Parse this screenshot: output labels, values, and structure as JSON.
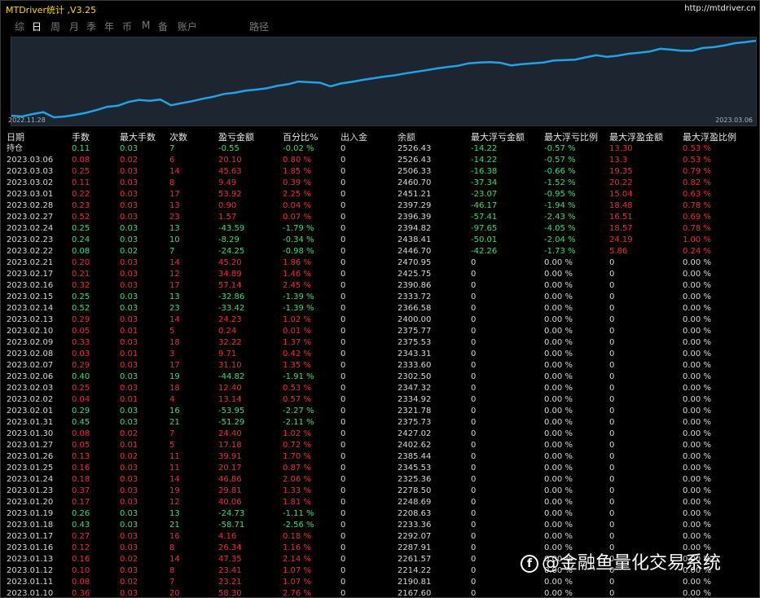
{
  "app": {
    "title": "MTDriver统计 ,V3.25",
    "link": "http://mtdriver.cn"
  },
  "menu": [
    {
      "label": "综",
      "active": false
    },
    {
      "label": "日",
      "active": true
    },
    {
      "label": "周",
      "active": false
    },
    {
      "label": "月",
      "active": false
    },
    {
      "label": "季",
      "active": false
    },
    {
      "label": "年",
      "active": false
    },
    {
      "label": "币",
      "active": false
    },
    {
      "label": "M",
      "active": false
    },
    {
      "label": "备",
      "active": false
    },
    {
      "label": "账户",
      "active": false
    },
    {
      "label": "路径",
      "active": false
    }
  ],
  "chart": {
    "date_start": "2022.11.28",
    "date_end": "2023.03.06",
    "line_color": "#22a3e8",
    "bg_color": "#1c2530"
  },
  "chart_data": {
    "type": "line",
    "x": [
      "2022.11.28",
      "2023.03.06"
    ],
    "series": [
      {
        "values": [
          2050,
          2045,
          2060,
          2072,
          2040,
          2045,
          2055,
          2068,
          2085,
          2105,
          2112,
          2135,
          2148,
          2142,
          2150,
          2115,
          2128,
          2140,
          2155,
          2168,
          2185,
          2192,
          2205,
          2212,
          2220,
          2235,
          2245,
          2262,
          2258,
          2255,
          2232,
          2250,
          2260,
          2272,
          2282,
          2292,
          2300,
          2312,
          2322,
          2332,
          2343,
          2352,
          2360,
          2375,
          2380,
          2382,
          2378,
          2362,
          2370,
          2375,
          2380,
          2392,
          2395,
          2398,
          2412,
          2425,
          2415,
          2422,
          2434,
          2440,
          2448,
          2465,
          2460,
          2453,
          2453,
          2470,
          2475,
          2485,
          2500,
          2506,
          2515
        ]
      }
    ]
  },
  "table": {
    "headers": [
      "日期",
      "手数",
      "最大手数",
      "次数",
      "盈亏金额",
      "百分比%",
      "出入金",
      "余额",
      "最大浮亏金额",
      "最大浮亏比例",
      "最大浮盈金额",
      "最大浮盈比例"
    ],
    "rows": [
      {
        "cells": [
          "持仓",
          "0.11",
          "0.03",
          "7",
          "-0.55",
          "-0.02 %",
          "0",
          "2526.43",
          "-14.22",
          "-0.57 %",
          "13.30",
          "0.53 %"
        ],
        "sign": "neg",
        "f1": "float-neg",
        "f2": "float-pos"
      },
      {
        "cells": [
          "2023.03.06",
          "0.08",
          "0.02",
          "6",
          "20.10",
          "0.80 %",
          "0",
          "2526.43",
          "-14.22",
          "-0.57 %",
          "13.3",
          "0.53 %"
        ],
        "sign": "pos",
        "f1": "float-neg",
        "f2": "float-pos"
      },
      {
        "cells": [
          "2023.03.03",
          "0.25",
          "0.03",
          "14",
          "45.63",
          "1.85 %",
          "0",
          "2506.33",
          "-16.38",
          "-0.66 %",
          "19.35",
          "0.79 %"
        ],
        "sign": "pos",
        "f1": "float-neg",
        "f2": "float-pos"
      },
      {
        "cells": [
          "2023.03.02",
          "0.11",
          "0.03",
          "8",
          "9.49",
          "0.39 %",
          "0",
          "2460.70",
          "-37.34",
          "-1.52 %",
          "20.22",
          "0.82 %"
        ],
        "sign": "pos",
        "f1": "float-neg",
        "f2": "float-pos"
      },
      {
        "cells": [
          "2023.03.01",
          "0.22",
          "0.03",
          "17",
          "53.92",
          "2.25 %",
          "0",
          "2451.21",
          "-23.07",
          "-0.95 %",
          "15.04",
          "0.63 %"
        ],
        "sign": "pos",
        "f1": "float-neg",
        "f2": "float-pos"
      },
      {
        "cells": [
          "2023.02.28",
          "0.23",
          "0.03",
          "13",
          "0.90",
          "0.04 %",
          "0",
          "2397.29",
          "-46.17",
          "-1.94 %",
          "18.48",
          "0.78 %"
        ],
        "sign": "pos",
        "f1": "float-neg",
        "f2": "float-pos"
      },
      {
        "cells": [
          "2023.02.27",
          "0.52",
          "0.03",
          "23",
          "1.57",
          "0.07 %",
          "0",
          "2396.39",
          "-57.41",
          "-2.43 %",
          "16.51",
          "0.69 %"
        ],
        "sign": "pos",
        "f1": "float-neg",
        "f2": "float-pos"
      },
      {
        "cells": [
          "2023.02.24",
          "0.25",
          "0.03",
          "13",
          "-43.59",
          "-1.79 %",
          "0",
          "2394.82",
          "-97.65",
          "-4.05 %",
          "18.57",
          "0.78 %"
        ],
        "sign": "neg",
        "f1": "float-neg",
        "f2": "float-pos"
      },
      {
        "cells": [
          "2023.02.23",
          "0.24",
          "0.03",
          "10",
          "-8.29",
          "-0.34 %",
          "0",
          "2438.41",
          "-50.01",
          "-2.04 %",
          "24.19",
          "1.00 %"
        ],
        "sign": "neg",
        "f1": "float-neg",
        "f2": "float-pos"
      },
      {
        "cells": [
          "2023.02.22",
          "0.08",
          "0.02",
          "7",
          "-24.25",
          "-0.98 %",
          "0",
          "2446.70",
          "-42.26",
          "-1.73 %",
          "5.86",
          "0.24 %"
        ],
        "sign": "neg",
        "f1": "float-neg",
        "f2": "float-pos"
      },
      {
        "cells": [
          "2023.02.21",
          "0.20",
          "0.03",
          "14",
          "45.20",
          "1.86 %",
          "0",
          "2470.95",
          "0",
          "0.00 %",
          "0",
          "0.00 %"
        ],
        "sign": "pos",
        "f1": "float-zero",
        "f2": "float-zero"
      },
      {
        "cells": [
          "2023.02.17",
          "0.21",
          "0.03",
          "12",
          "34.89",
          "1.46 %",
          "0",
          "2425.75",
          "0",
          "0.00 %",
          "0",
          "0.00 %"
        ],
        "sign": "pos",
        "f1": "float-zero",
        "f2": "float-zero"
      },
      {
        "cells": [
          "2023.02.16",
          "0.32",
          "0.03",
          "17",
          "57.14",
          "2.45 %",
          "0",
          "2390.86",
          "0",
          "0.00 %",
          "0",
          "0.00 %"
        ],
        "sign": "pos",
        "f1": "float-zero",
        "f2": "float-zero"
      },
      {
        "cells": [
          "2023.02.15",
          "0.25",
          "0.03",
          "13",
          "-32.86",
          "-1.39 %",
          "0",
          "2333.72",
          "0",
          "0.00 %",
          "0",
          "0.00 %"
        ],
        "sign": "neg",
        "f1": "float-zero",
        "f2": "float-zero"
      },
      {
        "cells": [
          "2023.02.14",
          "0.52",
          "0.03",
          "23",
          "-33.42",
          "-1.39 %",
          "0",
          "2366.58",
          "0",
          "0.00 %",
          "0",
          "0.00 %"
        ],
        "sign": "neg",
        "f1": "float-zero",
        "f2": "float-zero"
      },
      {
        "cells": [
          "2023.02.13",
          "0.29",
          "0.03",
          "14",
          "24.23",
          "1.02 %",
          "0",
          "2400.00",
          "0",
          "0.00 %",
          "0",
          "0.00 %"
        ],
        "sign": "pos",
        "f1": "float-zero",
        "f2": "float-zero"
      },
      {
        "cells": [
          "2023.02.10",
          "0.05",
          "0.01",
          "5",
          "0.24",
          "0.01 %",
          "0",
          "2375.77",
          "0",
          "0.00 %",
          "0",
          "0.00 %"
        ],
        "sign": "pos",
        "f1": "float-zero",
        "f2": "float-zero"
      },
      {
        "cells": [
          "2023.02.09",
          "0.33",
          "0.03",
          "18",
          "32.22",
          "1.37 %",
          "0",
          "2375.53",
          "0",
          "0.00 %",
          "0",
          "0.00 %"
        ],
        "sign": "pos",
        "f1": "float-zero",
        "f2": "float-zero"
      },
      {
        "cells": [
          "2023.02.08",
          "0.03",
          "0.01",
          "3",
          "9.71",
          "0.42 %",
          "0",
          "2343.31",
          "0",
          "0.00 %",
          "0",
          "0.00 %"
        ],
        "sign": "pos",
        "f1": "float-zero",
        "f2": "float-zero"
      },
      {
        "cells": [
          "2023.02.07",
          "0.29",
          "0.03",
          "17",
          "31.10",
          "1.35 %",
          "0",
          "2333.60",
          "0",
          "0.00 %",
          "0",
          "0.00 %"
        ],
        "sign": "pos",
        "f1": "float-zero",
        "f2": "float-zero"
      },
      {
        "cells": [
          "2023.02.06",
          "0.40",
          "0.03",
          "19",
          "-44.82",
          "-1.91 %",
          "0",
          "2302.50",
          "0",
          "0.00 %",
          "0",
          "0.00 %"
        ],
        "sign": "neg",
        "f1": "float-zero",
        "f2": "float-zero"
      },
      {
        "cells": [
          "2023.02.03",
          "0.25",
          "0.03",
          "18",
          "12.40",
          "0.53 %",
          "0",
          "2347.32",
          "0",
          "0.00 %",
          "0",
          "0.00 %"
        ],
        "sign": "pos",
        "f1": "float-zero",
        "f2": "float-zero"
      },
      {
        "cells": [
          "2023.02.02",
          "0.04",
          "0.01",
          "4",
          "13.14",
          "0.57 %",
          "0",
          "2334.92",
          "0",
          "0.00 %",
          "0",
          "0.00 %"
        ],
        "sign": "pos",
        "f1": "float-zero",
        "f2": "float-zero"
      },
      {
        "cells": [
          "2023.02.01",
          "0.29",
          "0.03",
          "16",
          "-53.95",
          "-2.27 %",
          "0",
          "2321.78",
          "0",
          "0.00 %",
          "0",
          "0.00 %"
        ],
        "sign": "neg",
        "f1": "float-zero",
        "f2": "float-zero"
      },
      {
        "cells": [
          "2023.01.31",
          "0.45",
          "0.03",
          "21",
          "-51.29",
          "-2.11 %",
          "0",
          "2375.73",
          "0",
          "0.00 %",
          "0",
          "0.00 %"
        ],
        "sign": "neg",
        "f1": "float-zero",
        "f2": "float-zero"
      },
      {
        "cells": [
          "2023.01.30",
          "0.08",
          "0.02",
          "7",
          "24.40",
          "1.02 %",
          "0",
          "2427.02",
          "0",
          "0.00 %",
          "0",
          "0.00 %"
        ],
        "sign": "pos",
        "f1": "float-zero",
        "f2": "float-zero"
      },
      {
        "cells": [
          "2023.01.27",
          "0.05",
          "0.01",
          "5",
          "17.18",
          "0.72 %",
          "0",
          "2402.62",
          "0",
          "0.00 %",
          "0",
          "0.00 %"
        ],
        "sign": "pos",
        "f1": "float-zero",
        "f2": "float-zero"
      },
      {
        "cells": [
          "2023.01.26",
          "0.13",
          "0.02",
          "11",
          "39.91",
          "1.70 %",
          "0",
          "2385.44",
          "0",
          "0.00 %",
          "0",
          "0.00 %"
        ],
        "sign": "pos",
        "f1": "float-zero",
        "f2": "float-zero"
      },
      {
        "cells": [
          "2023.01.25",
          "0.16",
          "0.03",
          "11",
          "20.17",
          "0.87 %",
          "0",
          "2345.53",
          "0",
          "0.00 %",
          "0",
          "0.00 %"
        ],
        "sign": "pos",
        "f1": "float-zero",
        "f2": "float-zero"
      },
      {
        "cells": [
          "2023.01.24",
          "0.18",
          "0.03",
          "14",
          "46.86",
          "2.06 %",
          "0",
          "2325.36",
          "0",
          "0.00 %",
          "0",
          "0.00 %"
        ],
        "sign": "pos",
        "f1": "float-zero",
        "f2": "float-zero"
      },
      {
        "cells": [
          "2023.01.23",
          "0.37",
          "0.03",
          "19",
          "29.81",
          "1.33 %",
          "0",
          "2278.50",
          "0",
          "0.00 %",
          "0",
          "0.00 %"
        ],
        "sign": "pos",
        "f1": "float-zero",
        "f2": "float-zero"
      },
      {
        "cells": [
          "2023.01.20",
          "0.17",
          "0.03",
          "12",
          "40.06",
          "1.81 %",
          "0",
          "2248.69",
          "0",
          "0.00 %",
          "0",
          "0.00 %"
        ],
        "sign": "pos",
        "f1": "float-zero",
        "f2": "float-zero"
      },
      {
        "cells": [
          "2023.01.19",
          "0.26",
          "0.03",
          "13",
          "-24.73",
          "-1.11 %",
          "0",
          "2208.63",
          "0",
          "0.00 %",
          "0",
          "0.00 %"
        ],
        "sign": "neg",
        "f1": "float-zero",
        "f2": "float-zero"
      },
      {
        "cells": [
          "2023.01.18",
          "0.43",
          "0.03",
          "21",
          "-58.71",
          "-2.56 %",
          "0",
          "2233.36",
          "0",
          "0.00 %",
          "0",
          "0.00 %"
        ],
        "sign": "neg",
        "f1": "float-zero",
        "f2": "float-zero"
      },
      {
        "cells": [
          "2023.01.17",
          "0.27",
          "0.03",
          "16",
          "4.16",
          "0.18 %",
          "0",
          "2292.07",
          "0",
          "0.00 %",
          "0",
          "0.00 %"
        ],
        "sign": "pos",
        "f1": "float-zero",
        "f2": "float-zero"
      },
      {
        "cells": [
          "2023.01.16",
          "0.12",
          "0.03",
          "8",
          "26.34",
          "1.16 %",
          "0",
          "2287.91",
          "0",
          "0.00 %",
          "0",
          "0.00 %"
        ],
        "sign": "pos",
        "f1": "float-zero",
        "f2": "float-zero"
      },
      {
        "cells": [
          "2023.01.13",
          "0.16",
          "0.02",
          "14",
          "47.35",
          "2.14 %",
          "0",
          "2261.57",
          "0",
          "0.00 %",
          "0",
          "0.00 %"
        ],
        "sign": "pos",
        "f1": "float-zero",
        "f2": "float-zero"
      },
      {
        "cells": [
          "2023.01.12",
          "0.10",
          "0.03",
          "8",
          "23.41",
          "1.07 %",
          "0",
          "2214.22",
          "0",
          "0.00 %",
          "0",
          "0.00 %"
        ],
        "sign": "pos",
        "f1": "float-zero",
        "f2": "float-zero"
      },
      {
        "cells": [
          "2023.01.11",
          "0.08",
          "0.02",
          "7",
          "23.21",
          "1.07 %",
          "0",
          "2190.81",
          "0",
          "0.00 %",
          "0",
          "0.00 %"
        ],
        "sign": "pos",
        "f1": "float-zero",
        "f2": "float-zero"
      },
      {
        "cells": [
          "2023.01.10",
          "0.36",
          "0.03",
          "20",
          "58.30",
          "2.76 %",
          "0",
          "2167.60",
          "0",
          "0.00 %",
          "0",
          "0.00 %"
        ],
        "sign": "pos",
        "f1": "float-zero",
        "f2": "float-zero"
      }
    ]
  },
  "watermark": {
    "icon": "f",
    "text": "@金融鱼量化交易系统"
  }
}
